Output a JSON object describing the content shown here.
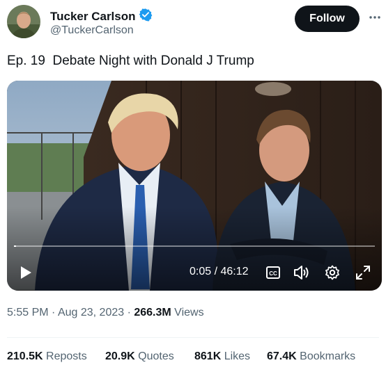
{
  "author": {
    "display_name": "Tucker Carlson",
    "handle": "@TuckerCarlson",
    "verified_icon": "verified-badge-icon",
    "brand_color": "#1d9bf0"
  },
  "actions": {
    "follow_label": "Follow",
    "more_icon": "more-dots-icon"
  },
  "tweet": {
    "text": "Ep. 19  Debate Night with Donald J Trump"
  },
  "video": {
    "current_time": "0:05",
    "separator": " / ",
    "duration": "46:12",
    "progress": 0.002,
    "icons": [
      "play-icon",
      "captions-icon",
      "volume-icon",
      "settings-icon",
      "fullscreen-icon"
    ]
  },
  "meta": {
    "time": "5:55 PM",
    "dot1": " · ",
    "date": "Aug 23, 2023",
    "dot2": " · ",
    "views_count": "266.3M",
    "views_label": " Views"
  },
  "stats": {
    "reposts_count": "210.5K",
    "reposts_label": " Reposts",
    "quotes_count": "20.9K",
    "quotes_label": " Quotes",
    "likes_count": "861K",
    "likes_label": " Likes",
    "bookmarks_count": "67.4K",
    "bookmarks_label": " Bookmarks"
  }
}
